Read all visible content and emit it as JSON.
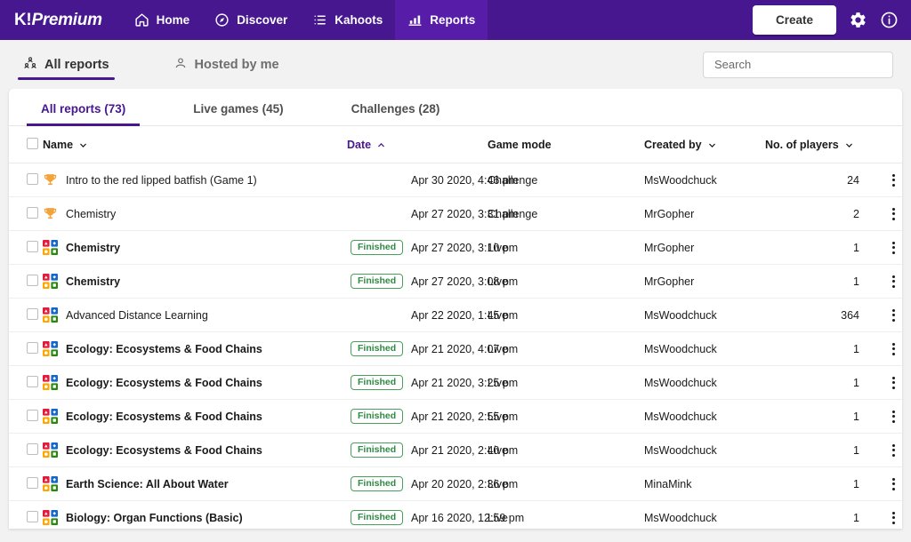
{
  "topnav": {
    "brand_k": "K!",
    "brand_premium": "Premium",
    "items": [
      {
        "label": "Home",
        "icon": "home-icon",
        "active": false
      },
      {
        "label": "Discover",
        "icon": "compass-icon",
        "active": false
      },
      {
        "label": "Kahoots",
        "icon": "list-icon",
        "active": false
      },
      {
        "label": "Reports",
        "icon": "bar-chart-icon",
        "active": true
      }
    ],
    "create_label": "Create",
    "settings_icon": "gear-icon",
    "info_icon": "info-icon",
    "bg_color": "#46178f",
    "active_item_bg": "#571ca8"
  },
  "subtabs": {
    "items": [
      {
        "label": "All reports",
        "icon": "people-group-icon",
        "active": true
      },
      {
        "label": "Hosted by me",
        "icon": "person-icon",
        "active": false
      }
    ],
    "accent_color": "#46178f"
  },
  "search": {
    "placeholder": "Search",
    "value": ""
  },
  "card_tabs": [
    {
      "label": "All reports (73)",
      "active": true
    },
    {
      "label": "Live games (45)",
      "active": false
    },
    {
      "label": "Challenges (28)",
      "active": false
    }
  ],
  "table": {
    "headers": {
      "select_all": "",
      "name": "Name",
      "date": "Date",
      "game_mode": "Game mode",
      "created_by": "Created by",
      "players": "No. of players"
    },
    "sort": {
      "column": "Date",
      "direction": "asc",
      "indicator": "chevron-up"
    },
    "rows": [
      {
        "icon": "trophy-icon",
        "name": "Intro to the red lipped batfish (Game 1)",
        "bold": false,
        "badge": "",
        "date": "Apr 30 2020, 4:46 pm",
        "mode": "Challenge",
        "by": "MsWoodchuck",
        "players": "24"
      },
      {
        "icon": "trophy-icon",
        "name": "Chemistry",
        "bold": false,
        "badge": "",
        "date": "Apr 27 2020, 3:31 pm",
        "mode": "Challenge",
        "by": "MrGopher",
        "players": "2"
      },
      {
        "icon": "kahoot-grid-icon",
        "name": "Chemistry",
        "bold": true,
        "badge": "Finished",
        "date": "Apr 27 2020, 3:10 pm",
        "mode": "Live",
        "by": "MrGopher",
        "players": "1"
      },
      {
        "icon": "kahoot-grid-icon",
        "name": "Chemistry",
        "bold": true,
        "badge": "Finished",
        "date": "Apr 27 2020, 3:08 pm",
        "mode": "Live",
        "by": "MrGopher",
        "players": "1"
      },
      {
        "icon": "kahoot-grid-icon",
        "name": "Advanced Distance Learning",
        "bold": false,
        "badge": "",
        "date": "Apr 22 2020, 1:45 pm",
        "mode": "Live",
        "by": "MsWoodchuck",
        "players": "364"
      },
      {
        "icon": "kahoot-grid-icon",
        "name": "Ecology: Ecosystems & Food Chains",
        "bold": true,
        "badge": "Finished",
        "date": "Apr 21 2020, 4:07 pm",
        "mode": "Live",
        "by": "MsWoodchuck",
        "players": "1"
      },
      {
        "icon": "kahoot-grid-icon",
        "name": "Ecology: Ecosystems & Food Chains",
        "bold": true,
        "badge": "Finished",
        "date": "Apr 21 2020, 3:25 pm",
        "mode": "Live",
        "by": "MsWoodchuck",
        "players": "1"
      },
      {
        "icon": "kahoot-grid-icon",
        "name": "Ecology: Ecosystems & Food Chains",
        "bold": true,
        "badge": "Finished",
        "date": "Apr 21 2020, 2:55 pm",
        "mode": "Live",
        "by": "MsWoodchuck",
        "players": "1"
      },
      {
        "icon": "kahoot-grid-icon",
        "name": "Ecology: Ecosystems & Food Chains",
        "bold": true,
        "badge": "Finished",
        "date": "Apr 21 2020, 2:40 pm",
        "mode": "Live",
        "by": "MsWoodchuck",
        "players": "1"
      },
      {
        "icon": "kahoot-grid-icon",
        "name": "Earth Science: All About Water",
        "bold": true,
        "badge": "Finished",
        "date": "Apr 20 2020, 2:36 pm",
        "mode": "Live",
        "by": "MinaMink",
        "players": "1"
      },
      {
        "icon": "kahoot-grid-icon",
        "name": "Biology: Organ Functions (Basic)",
        "bold": true,
        "badge": "Finished",
        "date": "Apr 16 2020, 12:59 pm",
        "mode": "Live",
        "by": "MsWoodchuck",
        "players": "1"
      }
    ],
    "badge_color": "#2f8a43",
    "row_menu_icon": "kebab-menu-icon"
  }
}
